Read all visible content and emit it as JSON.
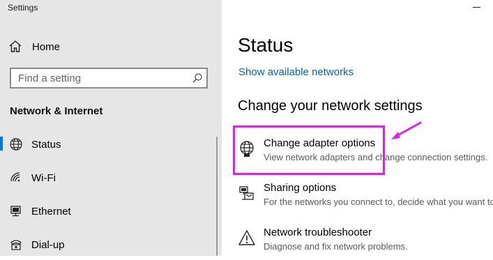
{
  "window": {
    "title": "Settings"
  },
  "sidebar": {
    "home_label": "Home",
    "search_placeholder": "Find a setting",
    "section_title": "Network & Internet",
    "items": [
      {
        "label": "Status",
        "icon": "globe-icon",
        "selected": true
      },
      {
        "label": "Wi-Fi",
        "icon": "wifi-icon",
        "selected": false
      },
      {
        "label": "Ethernet",
        "icon": "ethernet-icon",
        "selected": false
      },
      {
        "label": "Dial-up",
        "icon": "dialup-icon",
        "selected": false
      }
    ]
  },
  "main": {
    "title": "Status",
    "show_networks_link": "Show available networks",
    "change_settings_heading": "Change your network settings",
    "settings": [
      {
        "title": "Change adapter options",
        "description": "View network adapters and change connection settings.",
        "icon": "adapter-globe-icon"
      },
      {
        "title": "Sharing options",
        "description": "For the networks you connect to, decide what you want to",
        "icon": "sharing-icon"
      },
      {
        "title": "Network troubleshooter",
        "description": "Diagnose and fix network problems.",
        "icon": "warning-icon"
      }
    ]
  },
  "colors": {
    "sidebar_bg": "#e6e6e6",
    "accent": "#0078d7",
    "link": "#0063b1",
    "highlight": "#e020e8"
  }
}
